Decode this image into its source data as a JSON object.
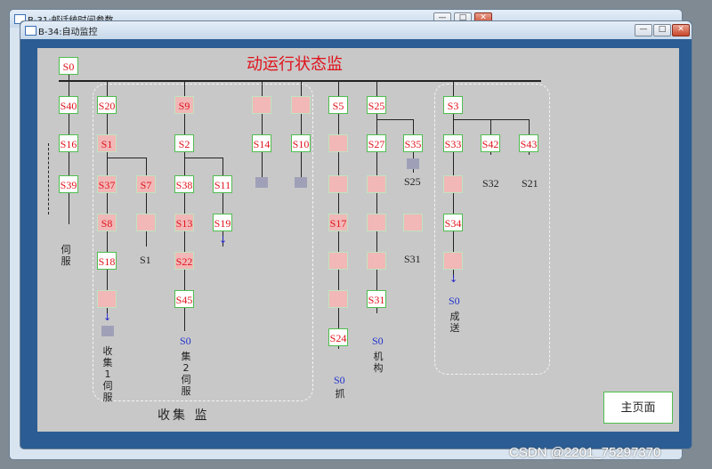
{
  "windows": [
    {
      "title": "B-31:邮话统时间参数"
    },
    {
      "title": "B-34:自动监控"
    }
  ],
  "window_buttons": {
    "minimize": "—",
    "maximize": "□",
    "close": "✕"
  },
  "canvas": {
    "title_visible": "动运行状态监",
    "group_label": "收集 监",
    "main_page_button": "主页面",
    "states": {
      "s0": "S0",
      "s40": "S40",
      "s16": "S16",
      "s39": "S39",
      "s20": "S20",
      "s1": "S1",
      "s37": "S37",
      "s7": "S7",
      "s8": "S8",
      "s18": "S18",
      "s9": "S9",
      "s2": "S2",
      "s38": "S38",
      "s11": "S11",
      "s13": "S13",
      "s19": "S19",
      "s22": "S22",
      "s45": "S45",
      "s14": "S14",
      "s10": "S10",
      "s5": "S5",
      "s25": "S25",
      "s27": "S27",
      "s35": "S35",
      "s17": "S17",
      "s24": "S24",
      "s31": "S31",
      "s3": "S3",
      "s33": "S33",
      "s42": "S42",
      "s43": "S43",
      "s34": "S34",
      "s32": "S32"
    },
    "jumps": {
      "j1": "S0",
      "j2": "S0",
      "j3": "S0",
      "j4": "S0",
      "j5": "S0",
      "j6": "S0"
    },
    "jump_labels": {
      "s25": "S25",
      "s31": "S31",
      "s32": "S32",
      "s21": "S21",
      "s1": "S1"
    },
    "vertical_text": {
      "servo": "伺服",
      "collect1": "收集1伺服",
      "collect2": "集2伺服",
      "grab": "抓",
      "mech": "机构",
      "done": "成 送"
    }
  },
  "watermark": "CSDN @2201_75297370"
}
